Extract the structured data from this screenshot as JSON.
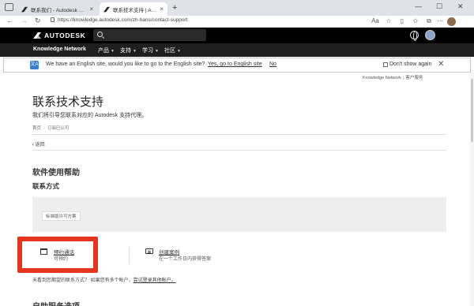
{
  "browser": {
    "tabs": [
      {
        "title": "联系我们 - Autodesk 联系美国服务",
        "active": false
      },
      {
        "title": "联系技术支持 | Autodesk Knowledge Network",
        "active": true
      }
    ],
    "url": "https://knowledge.autodesk.com/zh-hans/contact-support",
    "new_tab": "+",
    "window_controls": {
      "minimize": "—",
      "maximize": "☐",
      "close": "✕"
    }
  },
  "header": {
    "logo_text": "AUTODESK",
    "search_placeholder": "",
    "icons": [
      "search-icon",
      "globe-icon",
      "user-avatar"
    ]
  },
  "kn_nav": {
    "title": "Knowledge Network",
    "items": [
      {
        "label": "产品"
      },
      {
        "label": "支持"
      },
      {
        "label": "学习"
      },
      {
        "label": "社区"
      }
    ]
  },
  "banner": {
    "message": "We have an English site, would you like to go to the English site?",
    "yes_link": "Yes, go to English site",
    "no_link": "No",
    "dont_show": "Don't show again"
  },
  "top_breadcrumb": {
    "items": [
      "Knowledge Network",
      "客户服务"
    ]
  },
  "page": {
    "title": "联系技术支持",
    "subtitle": "我们将引导您联系对应的 Autodesk 支持代理。",
    "breadcrumb": [
      "首页",
      "订阅已认可"
    ],
    "back_label": "‹ 返回",
    "section_title": "软件使用帮助",
    "contact_heading": "联系方式",
    "chip_label": "标准版许可方案",
    "options": [
      {
        "title": "预约通话",
        "subtitle": "可预约",
        "icon": "calendar-icon"
      },
      {
        "title": "创建案例",
        "subtitle": "在一个工作日内获得答案",
        "icon": "message-icon"
      }
    ],
    "footer_question": "未看到您期望的联系方式？ 如果您有多个帐户，",
    "footer_link": "尝试登录其他帐户。",
    "next_section": "自助服务选项"
  },
  "colors": {
    "highlight": "#e5351f",
    "header_bg": "#000000",
    "nav_bg": "#1f1f1f"
  }
}
